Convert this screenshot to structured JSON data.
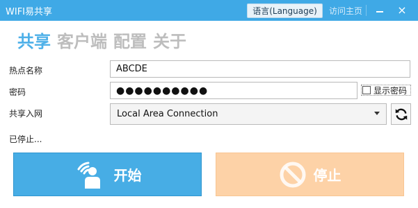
{
  "window": {
    "title": "WIFI易共享",
    "language_label": "语言(Language)",
    "home_link": "访问主页",
    "minimize_icon": "minimize-icon",
    "close_glyph": "×"
  },
  "tabs": [
    {
      "label": "共享",
      "active": true
    },
    {
      "label": "客户端",
      "active": false
    },
    {
      "label": "配置",
      "active": false
    },
    {
      "label": "关于",
      "active": false
    }
  ],
  "form": {
    "hotspot_label": "热点名称",
    "hotspot_value": "ABCDE",
    "password_label": "密码",
    "password_value": "●●●●●●●●●●",
    "show_password_label": "显示密码",
    "share_label": "共享入网",
    "share_selected": "Local Area Connection"
  },
  "status": "已停止...",
  "actions": {
    "start_label": "开始",
    "stop_label": "停止"
  },
  "colors": {
    "titlebar": "#3fa9e6",
    "accent": "#4db0e8",
    "start_button": "#47ade5",
    "stop_button": "#fdd2a7"
  }
}
